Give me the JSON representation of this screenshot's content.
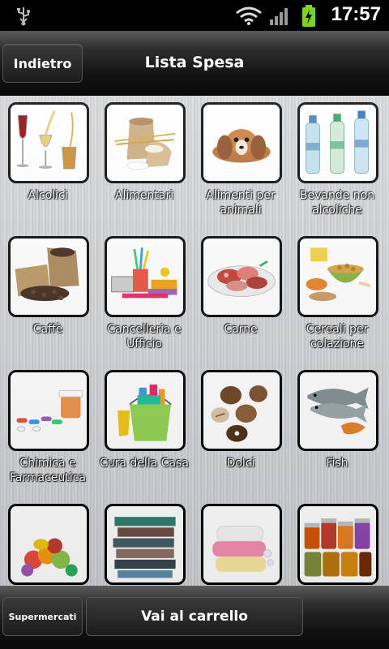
{
  "status_bar": {
    "time": "17:57",
    "icons": [
      "usb-icon",
      "wifi-icon",
      "signal-icon",
      "battery-charging-icon"
    ],
    "battery_color": "#7ed321"
  },
  "header": {
    "back_label": "Indietro",
    "title": "Lista Spesa"
  },
  "categories": [
    {
      "label": "Alcolici",
      "icon": "wine-glasses-icon"
    },
    {
      "label": "Alimentari",
      "icon": "grain-sacks-icon"
    },
    {
      "label": "Alimenti per animali",
      "icon": "puppy-icon"
    },
    {
      "label": "Bevande non alcoliche",
      "icon": "water-bottles-icon"
    },
    {
      "label": "Caffè",
      "icon": "coffee-beans-icon"
    },
    {
      "label": "Cancelleria e Ufficio",
      "icon": "stationery-icon"
    },
    {
      "label": "Carne",
      "icon": "meat-platter-icon"
    },
    {
      "label": "Cereali per colazione",
      "icon": "cereal-bowl-icon"
    },
    {
      "label": "Chimica e Farmaceutica",
      "icon": "pills-icon"
    },
    {
      "label": "Cura della Casa",
      "icon": "cleaning-bucket-icon"
    },
    {
      "label": "Dolci",
      "icon": "chocolates-icon"
    },
    {
      "label": "Fish",
      "icon": "fish-icon"
    },
    {
      "label": "",
      "icon": "fruit-icon"
    },
    {
      "label": "",
      "icon": "books-icon"
    },
    {
      "label": "",
      "icon": "soap-icon"
    },
    {
      "label": "",
      "icon": "jars-icon"
    }
  ],
  "bottom_bar": {
    "supermarkets_label": "Supermercati",
    "cart_label": "Vai al carrello"
  }
}
